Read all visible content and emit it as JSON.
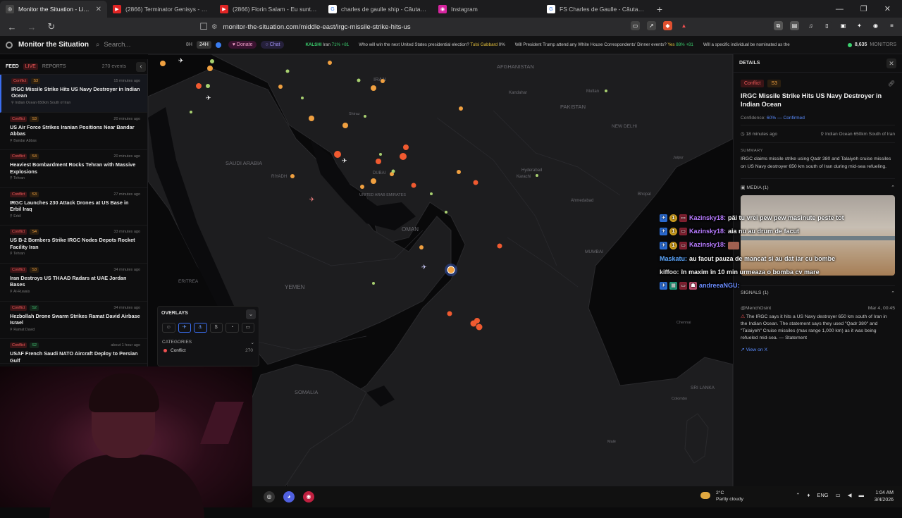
{
  "browser": {
    "tabs": [
      {
        "label": "Monitor the Situation - Live Glo",
        "icon": "globe-icon",
        "color": "#444444",
        "active": true
      },
      {
        "label": "(2866) Terminator Genisys - Nuke Sc",
        "icon": "youtube-icon",
        "color": "#e02525"
      },
      {
        "label": "(2866) Florin Salam - Eu sunt bomba",
        "icon": "youtube-icon",
        "color": "#e02525"
      },
      {
        "label": "charles de gaulle ship - Căutare Goog",
        "icon": "google-icon",
        "color": "#ffffff"
      },
      {
        "label": "Instagram",
        "icon": "instagram-icon",
        "color": "#d6249f"
      },
      {
        "label": "FS Charles de Gaulle - Căutare Googl",
        "icon": "google-icon",
        "color": "#ffffff"
      }
    ],
    "url": "monitor-the-situation.com/middle-east/irgc-missile-strike-hits-us"
  },
  "app": {
    "name": "Monitor the Situation",
    "search_placeholder": "Search...",
    "time_options": [
      "8H",
      "24H"
    ],
    "donate_label": "Donate",
    "chat_label": "Chat",
    "ticker": [
      {
        "source": "KALSHI",
        "label": "Iran",
        "pct": "71%",
        "delta": "+81"
      },
      {
        "label": "Who will win the next United States presidential election?",
        "pick": "Tulsi Gabbard",
        "pct": "0%"
      },
      {
        "label": "Will President Trump attend any White House Correspondents' Dinner events?",
        "pick": "Yes",
        "pct": "88%",
        "delta": "+81"
      },
      {
        "label": "Will a specific individual be nominated as the"
      }
    ],
    "monitors_count": "8,635",
    "monitors_label": "MONITORS"
  },
  "feed": {
    "tabs": [
      "FEED",
      "LIVE",
      "REPORTS"
    ],
    "count_label": "270 events",
    "items": [
      {
        "category": "Conflict",
        "severity": "S3",
        "time": "15 minutes ago",
        "title": "IRGC Missile Strike Hits US Navy Destroyer in Indian Ocean",
        "location": "Indian Ocean 650km South of Iran"
      },
      {
        "category": "Conflict",
        "severity": "S3",
        "time": "20 minutes ago",
        "title": "US Air Force Strikes Iranian Positions Near Bandar Abbas",
        "location": "Bandar Abbas"
      },
      {
        "category": "Conflict",
        "severity": "S4",
        "time": "20 minutes ago",
        "title": "Heaviest Bombardment Rocks Tehran with Massive Explosions",
        "location": "Tehran"
      },
      {
        "category": "Conflict",
        "severity": "S3",
        "time": "27 minutes ago",
        "title": "IRGC Launches 230 Attack Drones at US Base in Erbil Iraq",
        "location": "Erbil"
      },
      {
        "category": "Conflict",
        "severity": "S4",
        "time": "33 minutes ago",
        "title": "US B-2 Bombers Strike IRGC Nodes Depots Rocket Facility Iran",
        "location": "Tehran"
      },
      {
        "category": "Conflict",
        "severity": "S3",
        "time": "34 minutes ago",
        "title": "Iran Destroys US THAAD Radars at UAE Jordan Bases",
        "location": "Al-Ruwais"
      },
      {
        "category": "Conflict",
        "severity": "S2",
        "time": "34 minutes ago",
        "title": "Hezbollah Drone Swarm Strikes Ramat David Airbase Israel",
        "location": "Ramat David"
      },
      {
        "category": "Conflict",
        "severity": "S2",
        "time": "about 1 hour ago",
        "title": "USAF French Saudi NATO Aircraft Deploy to Persian Gulf",
        "location": ""
      }
    ]
  },
  "overlays": {
    "title": "OVERLAYS",
    "categories_title": "CATEGORIES",
    "category": {
      "name": "Conflict",
      "count": "270"
    }
  },
  "map_labels": [
    {
      "text": "AFGHANISTAN"
    },
    {
      "text": "PAKISTAN"
    },
    {
      "text": "IRAN"
    },
    {
      "text": "Kandahar"
    },
    {
      "text": "Multan"
    },
    {
      "text": "NEW DELHI"
    },
    {
      "text": "SAUDI ARABIA"
    },
    {
      "text": "RIYADH"
    },
    {
      "text": "DUBAI"
    },
    {
      "text": "UNITED ARAB EMIRATES"
    },
    {
      "text": "Karachi"
    },
    {
      "text": "Hyderabad"
    },
    {
      "text": "OMAN"
    },
    {
      "text": "Ahmedabad"
    },
    {
      "text": "Bhopal"
    },
    {
      "text": "MUMBAI"
    },
    {
      "text": "YEMEN"
    },
    {
      "text": "ERITREA"
    },
    {
      "text": "SOMALIA"
    },
    {
      "text": "SRI LANKA"
    },
    {
      "text": "Chennai"
    },
    {
      "text": "Colombo"
    },
    {
      "text": "Malé"
    },
    {
      "text": "Shiraz"
    },
    {
      "text": "Jaipur"
    }
  ],
  "details": {
    "header": "DETAILS",
    "category": "Conflict",
    "severity": "S3",
    "title": "IRGC Missile Strike Hits US Navy Destroyer in Indian Ocean",
    "confidence_label": "Confidence:",
    "confidence_value": "60% — Confirmed",
    "time": "18 minutes ago",
    "location": "Indian Ocean 650km South of Iran",
    "summary_title": "SUMMARY",
    "summary": "IRGC claims missile strike using Qadr 380 and Talaiyeh cruise missiles on US Navy destroyer 650 km south of Iran during mid-sea refueling.",
    "media_title": "MEDIA (1)",
    "signals_title": "SIGNALS (1)",
    "signal": {
      "author": "@MenchOsint",
      "date": "Mar 4, 00:45",
      "text": "The IRGC says it hits a US Navy destroyer 650 km south of Iran in the Indian Ocean. The statement says they used \"Qadr 380\" and \"Talaiyeh\" Cruise missiles (max range 1,000 km) as it was being refueled mid-sea. — Statement",
      "link": "View on X"
    }
  },
  "chat": [
    {
      "user": "Kazinsky18:",
      "msg": "păi tu vrei pew pew masinute peste tot",
      "badges": 3
    },
    {
      "user": "Kazinsky18:",
      "msg": "aia nu au drum de facut",
      "badges": 3
    },
    {
      "user": "Kazinsky18:",
      "msg": "",
      "badges": 3
    },
    {
      "user": "Maskatu:",
      "msg": "au facut pauza de mancat si au dat iar cu bombe",
      "badges": 0
    },
    {
      "user": "kiffoo:",
      "msg": "în maxim în 10 min urmeaza o bomba cv mare",
      "badges": 0
    },
    {
      "user": "andreeaNGU:",
      "msg": "",
      "badges": 4
    }
  ],
  "taskbar": {
    "weather_temp": "2°C",
    "weather_text": "Partly cloudy",
    "lang": "ENG",
    "time": "1:04 AM",
    "date": "3/4/2026"
  },
  "colors": {
    "accent": "#3a6df0",
    "conflict": "#f05a5a",
    "severity": "#f0a040",
    "confirmed": "#5a8cff"
  }
}
